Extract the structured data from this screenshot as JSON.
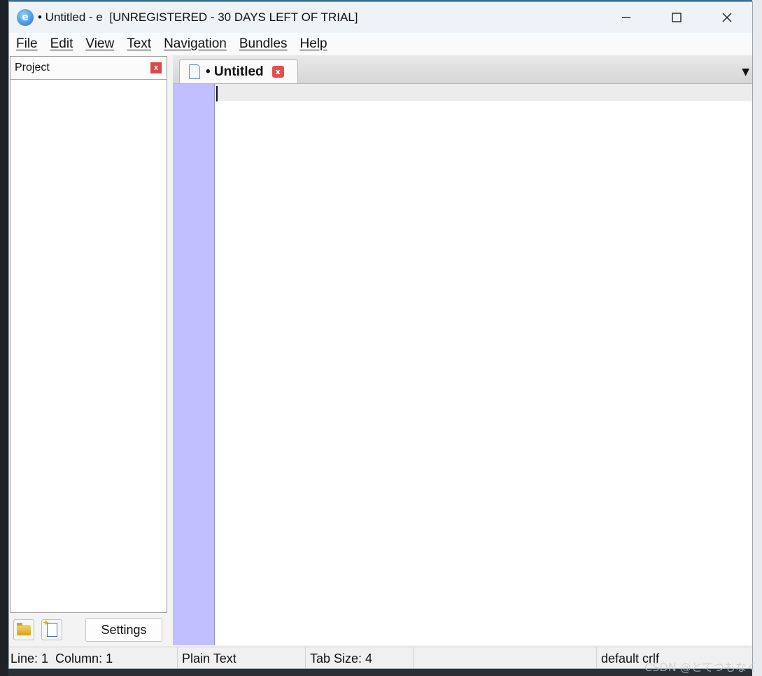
{
  "window": {
    "title": "• Untitled - e  [UNREGISTERED - 30 DAYS LEFT OF TRIAL]",
    "minimize_icon": "minimize-icon",
    "maximize_icon": "maximize-icon",
    "close_icon": "close-icon"
  },
  "menu": {
    "items": [
      "File",
      "Edit",
      "View",
      "Text",
      "Navigation",
      "Bundles",
      "Help"
    ]
  },
  "project_panel": {
    "title": "Project",
    "close_glyph": "x",
    "settings_label": "Settings"
  },
  "editor": {
    "tab_label": "• Untitled",
    "tab_close_glyph": "x",
    "dropdown_glyph": "▼",
    "gutter_color": "#c1bfff"
  },
  "status": {
    "position": "Line: 1  Column: 1",
    "syntax": "Plain Text",
    "tab_size": "Tab Size: 4",
    "encoding": "default crlf"
  },
  "watermark": "CSDN @とてつもなく"
}
